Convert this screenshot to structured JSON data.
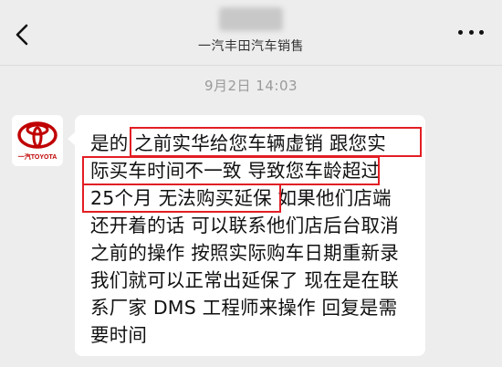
{
  "nav": {
    "back_icon": "chevron-left-icon",
    "contact_name_redacted": true,
    "subtitle": "一汽丰田汽车销售",
    "more_icon": "more-dots-icon"
  },
  "timestamp": "9月2日 14:03",
  "avatar": {
    "label": "一汽TOYOTA",
    "brand_color": "#c00000"
  },
  "message": {
    "lines": [
      "是的 之前实华给您车辆虚销 跟您实",
      "际买车时间不一致 导致您车龄超过",
      "25个月 无法购买延保 如果他们店端",
      "还开着的话 可以联系他们店后台取消",
      "之前的操作 按照实际购车日期重新录",
      "我们就可以正常出延保了 现在是在联",
      "系厂家 DMS 工程师来操作 回复是需",
      "要时间"
    ],
    "highlight_color": "#e31e24"
  },
  "colors": {
    "background": "#ededed",
    "bubble": "#ffffff",
    "timestamp": "#9a9a9a"
  }
}
